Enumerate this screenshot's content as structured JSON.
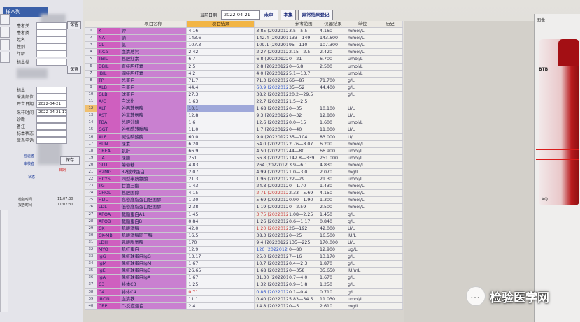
{
  "left_panel": {
    "tab": "样本列",
    "fields": [
      {
        "label": "患者关",
        "value": ""
      },
      {
        "label": "患者类",
        "value": ""
      },
      {
        "label": "姓名",
        "value": ""
      },
      {
        "label": "性别",
        "value": ""
      },
      {
        "label": "年龄",
        "value": ""
      },
      {
        "label": "标本类",
        "value": ""
      },
      {
        "label": "标本",
        "value": ""
      },
      {
        "label": "采集部位",
        "value": ""
      },
      {
        "label": "开立日期",
        "value": "2022-04-21"
      },
      {
        "label": "采样时间",
        "value": "2022-04-21 17:38"
      },
      {
        "label": "诊断",
        "value": ""
      },
      {
        "label": "备注",
        "value": ""
      },
      {
        "label": "标本状态",
        "value": ""
      },
      {
        "label": "联系电话",
        "value": ""
      }
    ],
    "save1": "保留",
    "save2": "保留",
    "save3": "保存",
    "checker_label": "检验者",
    "reviewer_label": "审核者",
    "status_label": "状态",
    "status_value": "日期",
    "checkbox_label": "急",
    "bottom_lines": [
      "检验时间",
      "报告时间"
    ],
    "bottom_times": [
      "11:07:30",
      "11:07:30"
    ]
  },
  "toolbar": {
    "date_label": "当前日期",
    "date_value": "2022-04-21",
    "buttons": [
      "未审",
      "本集",
      "异常结果登记"
    ]
  },
  "table": {
    "headers": [
      "",
      "",
      "项目名称",
      "项目结果",
      "前次结果"
    ],
    "rows": [
      {
        "idx": "1",
        "code": "K",
        "name": "钾",
        "val": "4.16",
        "prev": "3.85 (20220122)(血清)",
        "pc": ""
      },
      {
        "idx": "2",
        "code": "NA",
        "name": "钠",
        "val": "143.6",
        "prev": "142.4 (20220122)(血清)",
        "pc": ""
      },
      {
        "idx": "3",
        "code": "CL",
        "name": "氯",
        "val": "107.3",
        "prev": "109.1 (20220122)(血清)",
        "pc": ""
      },
      {
        "idx": "4",
        "code": "T.Ca",
        "name": "血清总钙",
        "val": "2.42",
        "prev": "2.27 (20220122)(血清)",
        "pc": ""
      },
      {
        "idx": "5",
        "code": "TBIL",
        "name": "总胆红素",
        "val": "6.7",
        "prev": "6.8 (20220122)(血清)",
        "pc": ""
      },
      {
        "idx": "6",
        "code": "DBIL",
        "name": "直接胆红素",
        "val": "2.5",
        "prev": "2.8 (20220122)(血清)",
        "pc": ""
      },
      {
        "idx": "7",
        "code": "IBIL",
        "name": "间接胆红素",
        "val": "4.2",
        "prev": "4.0 (20220122)(血清)",
        "pc": ""
      },
      {
        "idx": "8",
        "code": "TP",
        "name": "总蛋白",
        "val": "71.7",
        "prev": "71.3 (20220122)(血清)",
        "pc": ""
      },
      {
        "idx": "9",
        "code": "ALB",
        "name": "白蛋白",
        "val": "44.4",
        "prev": "60.9 (20220122)(血清)",
        "pc": "blue"
      },
      {
        "idx": "10",
        "code": "GLB",
        "name": "球蛋白",
        "val": "27.3",
        "prev": "38.2 (20220122)(血清)",
        "pc": ""
      },
      {
        "idx": "11",
        "code": "A/G",
        "name": "白球比",
        "val": "1.63",
        "prev": "22.7 (20220122)(血清)",
        "pc": ""
      },
      {
        "idx": "12",
        "code": "ALT",
        "name": "谷丙转氨酶",
        "val": "10.1",
        "prev": "1.68 (20220122)(血清)",
        "pc": ""
      },
      {
        "idx": "13",
        "code": "AST",
        "name": "谷草转氨酶",
        "val": "12.8",
        "prev": "9.3 (20220122)(血清)",
        "pc": ""
      },
      {
        "idx": "14",
        "code": "TBA",
        "name": "总胆汁酸",
        "val": "1.6",
        "prev": "12.6 (20220122)(血清)",
        "pc": ""
      },
      {
        "idx": "15",
        "code": "GGT",
        "name": "谷氨酰转肽酶",
        "val": "11.0",
        "prev": "1.7 (20220122)(血清)",
        "pc": ""
      },
      {
        "idx": "16",
        "code": "ALP",
        "name": "碱性磷酸酶",
        "val": "60.0",
        "prev": "9.0 (20220122)(血清)",
        "pc": ""
      },
      {
        "idx": "17",
        "code": "BUN",
        "name": "尿素",
        "val": "6.20",
        "prev": "54.0 (20220122)(血清)",
        "pc": ""
      },
      {
        "idx": "18",
        "code": "CREA",
        "name": "肌酐",
        "val": "66.9",
        "prev": "4.50 (20220122)(血清)",
        "pc": ""
      },
      {
        "idx": "19",
        "code": "UA",
        "name": "尿酸",
        "val": "251",
        "prev": "56.8 (20220122)(血清)",
        "pc": ""
      },
      {
        "idx": "20",
        "code": "GLU",
        "name": "葡萄糖",
        "val": "4.83",
        "prev": "264 (20220122)(血清)",
        "pc": ""
      },
      {
        "idx": "21",
        "code": "B2MG",
        "name": "β2微球蛋白",
        "val": "2.07",
        "prev": "4.99 (20220122)(血清)",
        "pc": ""
      },
      {
        "idx": "22",
        "code": "HCYS",
        "name": "同型半胱氨酸",
        "val": "21.3",
        "prev": "1.96 (20220122)(血清)",
        "pc": ""
      },
      {
        "idx": "23",
        "code": "TG",
        "name": "甘油三酯",
        "val": "1.43",
        "prev": "24.8 (20220122)(血清)",
        "pc": ""
      },
      {
        "idx": "24",
        "code": "CHOL",
        "name": "总胆固醇",
        "val": "4.15",
        "prev": "2.71 (20220122)(血清)",
        "pc": "red"
      },
      {
        "idx": "25",
        "code": "HDL",
        "name": "高密度脂蛋白胆固醇",
        "val": "1.30",
        "prev": "5.69 (20220122)(血清)",
        "pc": ""
      },
      {
        "idx": "26",
        "code": "LDL",
        "name": "低密度脂蛋白胆固醇",
        "val": "2.38",
        "prev": "1.19 (20220122)(血清)",
        "pc": ""
      },
      {
        "idx": "27",
        "code": "APOA",
        "name": "载脂蛋白A1",
        "val": "1.45",
        "prev": "3.75 (20220122)(血清)",
        "pc": "red"
      },
      {
        "idx": "28",
        "code": "APOB",
        "name": "载脂蛋白B",
        "val": "0.84",
        "prev": "1.26 (20220122)(血清)",
        "pc": ""
      },
      {
        "idx": "29",
        "code": "CK",
        "name": "肌酸激酶",
        "val": "42.0",
        "prev": "1.20 (20220122)(血清)",
        "pc": "red"
      },
      {
        "idx": "30",
        "code": "CK-MB",
        "name": "肌酸激酶同工酶",
        "val": "16.5",
        "prev": "38.3 (20220122)(血清)",
        "pc": ""
      },
      {
        "idx": "31",
        "code": "LDH",
        "name": "乳酸脱氢酶",
        "val": "170",
        "prev": "9.4 (20220122)(血清)",
        "pc": ""
      },
      {
        "idx": "32",
        "code": "MYO",
        "name": "肌红蛋白",
        "val": "12.9",
        "prev": "120 (20220122)(血清)",
        "pc": "blue"
      },
      {
        "idx": "33",
        "code": "IgG",
        "name": "免疫球蛋白IgG",
        "val": "13.17",
        "prev": "25.0 (20220122)(血清)",
        "pc": ""
      },
      {
        "idx": "34",
        "code": "IgM",
        "name": "免疫球蛋白IgM",
        "val": "1.67",
        "prev": "10.7 (20220122)(血清)",
        "pc": ""
      },
      {
        "idx": "35",
        "code": "IgE",
        "name": "免疫球蛋白IgE",
        "val": "26.65",
        "prev": "1.68 (20220122)(血清)",
        "pc": ""
      },
      {
        "idx": "36",
        "code": "IgA",
        "name": "免疫球蛋白IgA",
        "val": "1.67",
        "prev": "31.30 (20220122)(血清)",
        "pc": ""
      },
      {
        "idx": "37",
        "code": "C3",
        "name": "补体C3",
        "val": "1.25",
        "prev": "1.32 (20220122)(血清)",
        "pc": ""
      },
      {
        "idx": "38",
        "code": "C4",
        "name": "补体C4",
        "val": "0.71",
        "prev": "0.86 (20220122)(血清)",
        "pc": "blue",
        "vc": "red"
      },
      {
        "idx": "39",
        "code": "IRON",
        "name": "血清铁",
        "val": "11.1",
        "prev": "0.40 (20220122)(血清)",
        "pc": ""
      },
      {
        "idx": "40",
        "code": "CRP",
        "name": "C-反应蛋白",
        "val": "2.4",
        "prev": "14.8 (20220122)(血清)",
        "pc": ""
      }
    ],
    "selected_idx": "12"
  },
  "ref_table": {
    "headers": [
      "参考范围",
      "仪器结果",
      "单位",
      "历史"
    ],
    "rows": [
      [
        "3.5—5.5",
        "4.160",
        "mmol/L",
        ""
      ],
      [
        "133—149",
        "143.600",
        "mmol/L",
        ""
      ],
      [
        "95—110",
        "107.300",
        "mmol/L",
        ""
      ],
      [
        "2.15—2.5",
        "2.420",
        "mmol/L",
        ""
      ],
      [
        "0—21",
        "6.700",
        "umol/L",
        ""
      ],
      [
        "0—6.8",
        "2.500",
        "umol/L",
        ""
      ],
      [
        "5.1—13.7",
        "",
        "umol/L",
        ""
      ],
      [
        "66—87",
        "71.700",
        "g/L",
        ""
      ],
      [
        "35—52",
        "44.400",
        "g/L",
        ""
      ],
      [
        "20.2—29.5",
        "",
        "g/L",
        ""
      ],
      [
        "1.5—2.5",
        "",
        "",
        ""
      ],
      [
        "0—35",
        "10.100",
        "U/L",
        ""
      ],
      [
        "0—32",
        "12.800",
        "U/L",
        ""
      ],
      [
        "0.0—15",
        "1.600",
        "umol/L",
        ""
      ],
      [
        "0—40",
        "11.000",
        "U/L",
        ""
      ],
      [
        "35—104",
        "83.000",
        "U/L",
        ""
      ],
      [
        "2.76—8.07",
        "6.200",
        "mmol/L",
        ""
      ],
      [
        "44—80",
        "66.900",
        "umol/L",
        ""
      ],
      [
        "142.8—339",
        "251.000",
        "umol/L",
        ""
      ],
      [
        "3.9—6.1",
        "4.830",
        "mmol/L",
        ""
      ],
      [
        "1.0—3.0",
        "2.070",
        "mg/L",
        ""
      ],
      [
        "22—29",
        "21.30",
        "umol/L",
        ""
      ],
      [
        "0—1.70",
        "1.430",
        "mmol/L",
        ""
      ],
      [
        "2.33—5.69",
        "4.150",
        "mmol/L",
        ""
      ],
      [
        "0.90—1.90",
        "1.300",
        "mmol/L",
        ""
      ],
      [
        "0—2.59",
        "2.500",
        "mmol/L",
        ""
      ],
      [
        "1.08—2.25",
        "1.450",
        "g/L",
        ""
      ],
      [
        "0.6—1.17",
        "0.840",
        "g/L",
        ""
      ],
      [
        "26—192",
        "42.000",
        "U/L",
        ""
      ],
      [
        "0—25",
        "16.500",
        "IU/L",
        ""
      ],
      [
        "135—225",
        "170.000",
        "U/L",
        ""
      ],
      [
        "0—80",
        "12.900",
        "ug/L",
        ""
      ],
      [
        "7—16",
        "13.170",
        "g/L",
        ""
      ],
      [
        "0.4—2.3",
        "1.870",
        "g/L",
        ""
      ],
      [
        "0—358",
        "35.650",
        "IU/mL",
        ""
      ],
      [
        "0.7—4.0",
        "1.670",
        "g/L",
        ""
      ],
      [
        "0.9—1.8",
        "1.250",
        "g/L",
        ""
      ],
      [
        "0.1—0.4",
        "0.710",
        "g/L",
        ""
      ],
      [
        "5.83—34.5",
        "11.030",
        "umol/L",
        ""
      ],
      [
        "0—5",
        "2.610",
        "mg/L",
        ""
      ]
    ]
  },
  "photo": {
    "title": "图像",
    "tube_label": "BTB",
    "caption": "XQ"
  },
  "watermark": "检验医学网"
}
